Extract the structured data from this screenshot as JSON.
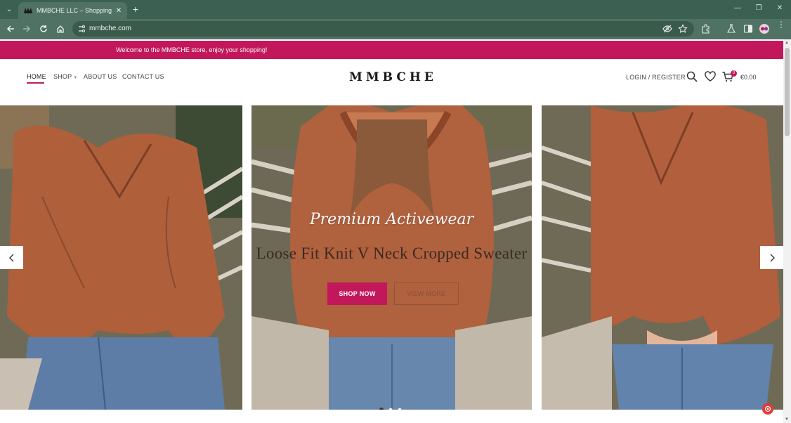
{
  "browser": {
    "tab_title": "MMBCHE LLC – Shopping",
    "url": "mmbche.com",
    "new_tab_symbol": "+",
    "tab_close_symbol": "✕"
  },
  "promo_bar": {
    "text": "Welcome to the MMBCHE store, enjoy your shopping!",
    "color": "#c2185b"
  },
  "header": {
    "nav": [
      {
        "label": "HOME",
        "active": true
      },
      {
        "label": "SHOP",
        "has_dropdown": true
      },
      {
        "label": "ABOUT US"
      },
      {
        "label": "CONTACT US"
      }
    ],
    "logo": "MMBCHE",
    "login_label": "LOGIN / REGISTER",
    "cart_count": "0",
    "cart_total": "€0.00",
    "icons": [
      "search-icon",
      "heart-icon",
      "cart-icon"
    ]
  },
  "slider": {
    "subtitle": "Premium Activewear",
    "title": "Loose Fit Knit V Neck Cropped Sweater",
    "shop_button": "SHOP NOW",
    "view_button": "VIEW MORE",
    "active_dot": 0,
    "dot_count": 3
  },
  "colors": {
    "accent": "#c2185b",
    "chrome_dark": "#3c6152",
    "chrome_light": "#4f7265"
  }
}
